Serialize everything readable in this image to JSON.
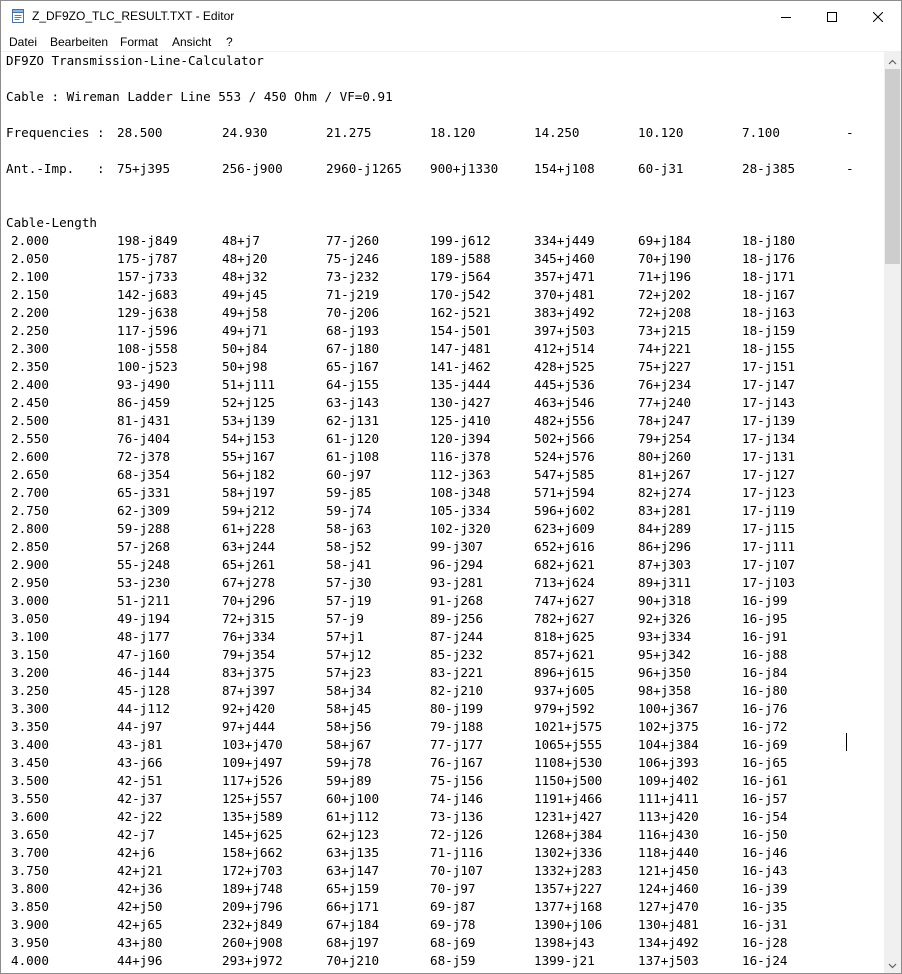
{
  "window": {
    "title": "Z_DF9ZO_TLC_RESULT.TXT - Editor",
    "app_icon": "notepad-icon",
    "controls": [
      "minimize-icon",
      "maximize-icon",
      "close-icon"
    ]
  },
  "menu": [
    "Datei",
    "Bearbeiten",
    "Format",
    "Ansicht",
    "?"
  ],
  "document": {
    "heading": "DF9ZO Transmission-Line-Calculator",
    "cable": "Cable : Wireman Ladder Line 553 / 450 Ohm / VF=0.91",
    "frequencies_label": "Frequencies :",
    "frequencies": [
      "28.500",
      "24.930",
      "21.275",
      "18.120",
      "14.250",
      "10.120",
      "7.100"
    ],
    "impedance_label": "Ant.-Imp.   :",
    "impedances": [
      "75+j395",
      "256-j900",
      "2960-j1265",
      "900+j1330",
      "154+j108",
      "60-j31",
      "28-j385"
    ],
    "overflow_marker": "-",
    "section_label": "Cable-Length",
    "rows": [
      {
        "length": "2.000",
        "values": [
          "198-j849",
          "48+j7",
          "77-j260",
          "199-j612",
          "334+j449",
          "69+j184",
          "18-j180"
        ]
      },
      {
        "length": "2.050",
        "values": [
          "175-j787",
          "48+j20",
          "75-j246",
          "189-j588",
          "345+j460",
          "70+j190",
          "18-j176"
        ]
      },
      {
        "length": "2.100",
        "values": [
          "157-j733",
          "48+j32",
          "73-j232",
          "179-j564",
          "357+j471",
          "71+j196",
          "18-j171"
        ]
      },
      {
        "length": "2.150",
        "values": [
          "142-j683",
          "49+j45",
          "71-j219",
          "170-j542",
          "370+j481",
          "72+j202",
          "18-j167"
        ]
      },
      {
        "length": "2.200",
        "values": [
          "129-j638",
          "49+j58",
          "70-j206",
          "162-j521",
          "383+j492",
          "72+j208",
          "18-j163"
        ]
      },
      {
        "length": "2.250",
        "values": [
          "117-j596",
          "49+j71",
          "68-j193",
          "154-j501",
          "397+j503",
          "73+j215",
          "18-j159"
        ]
      },
      {
        "length": "2.300",
        "values": [
          "108-j558",
          "50+j84",
          "67-j180",
          "147-j481",
          "412+j514",
          "74+j221",
          "18-j155"
        ]
      },
      {
        "length": "2.350",
        "values": [
          "100-j523",
          "50+j98",
          "65-j167",
          "141-j462",
          "428+j525",
          "75+j227",
          "17-j151"
        ]
      },
      {
        "length": "2.400",
        "values": [
          "93-j490",
          "51+j111",
          "64-j155",
          "135-j444",
          "445+j536",
          "76+j234",
          "17-j147"
        ]
      },
      {
        "length": "2.450",
        "values": [
          "86-j459",
          "52+j125",
          "63-j143",
          "130-j427",
          "463+j546",
          "77+j240",
          "17-j143"
        ]
      },
      {
        "length": "2.500",
        "values": [
          "81-j431",
          "53+j139",
          "62-j131",
          "125-j410",
          "482+j556",
          "78+j247",
          "17-j139"
        ]
      },
      {
        "length": "2.550",
        "values": [
          "76-j404",
          "54+j153",
          "61-j120",
          "120-j394",
          "502+j566",
          "79+j254",
          "17-j134"
        ]
      },
      {
        "length": "2.600",
        "values": [
          "72-j378",
          "55+j167",
          "61-j108",
          "116-j378",
          "524+j576",
          "80+j260",
          "17-j131"
        ]
      },
      {
        "length": "2.650",
        "values": [
          "68-j354",
          "56+j182",
          "60-j97",
          "112-j363",
          "547+j585",
          "81+j267",
          "17-j127"
        ]
      },
      {
        "length": "2.700",
        "values": [
          "65-j331",
          "58+j197",
          "59-j85",
          "108-j348",
          "571+j594",
          "82+j274",
          "17-j123"
        ]
      },
      {
        "length": "2.750",
        "values": [
          "62-j309",
          "59+j212",
          "59-j74",
          "105-j334",
          "596+j602",
          "83+j281",
          "17-j119"
        ]
      },
      {
        "length": "2.800",
        "values": [
          "59-j288",
          "61+j228",
          "58-j63",
          "102-j320",
          "623+j609",
          "84+j289",
          "17-j115"
        ]
      },
      {
        "length": "2.850",
        "values": [
          "57-j268",
          "63+j244",
          "58-j52",
          "99-j307",
          "652+j616",
          "86+j296",
          "17-j111"
        ]
      },
      {
        "length": "2.900",
        "values": [
          "55-j248",
          "65+j261",
          "58-j41",
          "96-j294",
          "682+j621",
          "87+j303",
          "17-j107"
        ]
      },
      {
        "length": "2.950",
        "values": [
          "53-j230",
          "67+j278",
          "57-j30",
          "93-j281",
          "713+j624",
          "89+j311",
          "17-j103"
        ]
      },
      {
        "length": "3.000",
        "values": [
          "51-j211",
          "70+j296",
          "57-j19",
          "91-j268",
          "747+j627",
          "90+j318",
          "16-j99"
        ]
      },
      {
        "length": "3.050",
        "values": [
          "49-j194",
          "72+j315",
          "57-j9",
          "89-j256",
          "782+j627",
          "92+j326",
          "16-j95"
        ]
      },
      {
        "length": "3.100",
        "values": [
          "48-j177",
          "76+j334",
          "57+j1",
          "87-j244",
          "818+j625",
          "93+j334",
          "16-j91"
        ]
      },
      {
        "length": "3.150",
        "values": [
          "47-j160",
          "79+j354",
          "57+j12",
          "85-j232",
          "857+j621",
          "95+j342",
          "16-j88"
        ]
      },
      {
        "length": "3.200",
        "values": [
          "46-j144",
          "83+j375",
          "57+j23",
          "83-j221",
          "896+j615",
          "96+j350",
          "16-j84"
        ]
      },
      {
        "length": "3.250",
        "values": [
          "45-j128",
          "87+j397",
          "58+j34",
          "82-j210",
          "937+j605",
          "98+j358",
          "16-j80"
        ]
      },
      {
        "length": "3.300",
        "values": [
          "44-j112",
          "92+j420",
          "58+j45",
          "80-j199",
          "979+j592",
          "100+j367",
          "16-j76"
        ]
      },
      {
        "length": "3.350",
        "values": [
          "44-j97",
          "97+j444",
          "58+j56",
          "79-j188",
          "1021+j575",
          "102+j375",
          "16-j72"
        ]
      },
      {
        "length": "3.400",
        "values": [
          "43-j81",
          "103+j470",
          "58+j67",
          "77-j177",
          "1065+j555",
          "104+j384",
          "16-j69"
        ]
      },
      {
        "length": "3.450",
        "values": [
          "43-j66",
          "109+j497",
          "59+j78",
          "76-j167",
          "1108+j530",
          "106+j393",
          "16-j65"
        ]
      },
      {
        "length": "3.500",
        "values": [
          "42-j51",
          "117+j526",
          "59+j89",
          "75-j156",
          "1150+j500",
          "109+j402",
          "16-j61"
        ]
      },
      {
        "length": "3.550",
        "values": [
          "42-j37",
          "125+j557",
          "60+j100",
          "74-j146",
          "1191+j466",
          "111+j411",
          "16-j57"
        ]
      },
      {
        "length": "3.600",
        "values": [
          "42-j22",
          "135+j589",
          "61+j112",
          "73-j136",
          "1231+j427",
          "113+j420",
          "16-j54"
        ]
      },
      {
        "length": "3.650",
        "values": [
          "42-j7",
          "145+j625",
          "62+j123",
          "72-j126",
          "1268+j384",
          "116+j430",
          "16-j50"
        ]
      },
      {
        "length": "3.700",
        "values": [
          "42+j6",
          "158+j662",
          "63+j135",
          "71-j116",
          "1302+j336",
          "118+j440",
          "16-j46"
        ]
      },
      {
        "length": "3.750",
        "values": [
          "42+j21",
          "172+j703",
          "63+j147",
          "70-j107",
          "1332+j283",
          "121+j450",
          "16-j43"
        ]
      },
      {
        "length": "3.800",
        "values": [
          "42+j36",
          "189+j748",
          "65+j159",
          "70-j97",
          "1357+j227",
          "124+j460",
          "16-j39"
        ]
      },
      {
        "length": "3.850",
        "values": [
          "42+j50",
          "209+j796",
          "66+j171",
          "69-j87",
          "1377+j168",
          "127+j470",
          "16-j35"
        ]
      },
      {
        "length": "3.900",
        "values": [
          "42+j65",
          "232+j849",
          "67+j184",
          "69-j78",
          "1390+j106",
          "130+j481",
          "16-j31"
        ]
      },
      {
        "length": "3.950",
        "values": [
          "43+j80",
          "260+j908",
          "68+j197",
          "68-j69",
          "1398+j43",
          "134+j492",
          "16-j28"
        ]
      },
      {
        "length": "4.000",
        "values": [
          "44+j96",
          "293+j972",
          "70+j210",
          "68-j59",
          "1399-j21",
          "137+j503",
          "16-j24"
        ]
      }
    ]
  }
}
